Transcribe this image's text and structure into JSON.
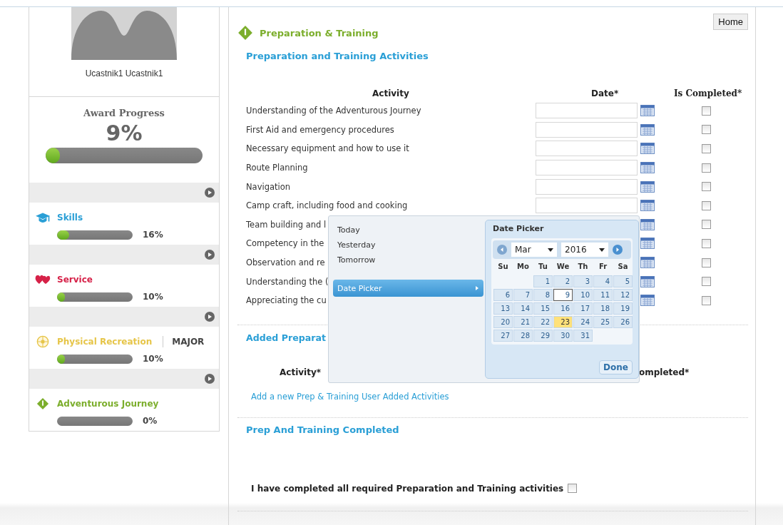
{
  "profile": {
    "name": "Ucastnik1 Ucastnik1"
  },
  "award_progress": {
    "title": "Award Progress",
    "percent": "9%",
    "level": 0.09
  },
  "categories": [
    {
      "kind": "skills",
      "name": "Skills",
      "color": "#2a9fd6",
      "percent": "16%",
      "level": 0.16
    },
    {
      "kind": "service",
      "name": "Service",
      "color": "#d62148",
      "percent": "10%",
      "level": 0.1
    },
    {
      "kind": "recreation",
      "name": "Physical Recreation",
      "color": "#e6c548",
      "percent": "10%",
      "level": 0.1,
      "tag": "MAJOR"
    },
    {
      "kind": "journey",
      "name": "Adventurous Journey",
      "color": "#7cae2c",
      "percent": "0%",
      "level": 0
    }
  ],
  "home_button": "Home",
  "page_title": "Preparation & Training",
  "activities_section": {
    "heading": "Preparation and Training Activities",
    "columns": [
      "Activity",
      "Date*",
      "Is Completed*"
    ],
    "rows": [
      {
        "activity": "Understanding of the Adventurous Journey",
        "checked": false
      },
      {
        "activity": "First Aid and emergency procedures",
        "checked": false
      },
      {
        "activity": "Necessary equipment and how to use it",
        "checked": false
      },
      {
        "activity": "Route Planning",
        "checked": false
      },
      {
        "activity": "Navigation",
        "checked": false
      },
      {
        "activity": "Camp craft, including food and cooking",
        "checked": false
      },
      {
        "activity": "Team building and l",
        "checked": false,
        "date_field_hidden": true
      },
      {
        "activity": "Competency in the",
        "checked": false,
        "date_field_hidden": true
      },
      {
        "activity": "Observation and re",
        "checked": false,
        "date_field_hidden": true
      },
      {
        "activity": "Understanding the (",
        "checked": false,
        "date_field_hidden": true
      },
      {
        "activity": "Appreciating the cu",
        "checked": false,
        "date_field_hidden": true
      }
    ]
  },
  "added_section": {
    "heading": "Added Preparat",
    "columns": [
      "Activity*",
      "ompleted*"
    ],
    "link": "Add a new Prep & Training User Added Activities"
  },
  "completed_section": {
    "heading": "Prep And Training Completed",
    "confirmation": "I have completed all required Preparation and Training activities",
    "checked": false
  },
  "date_popup": {
    "menu": [
      {
        "label": "Today",
        "selected": false
      },
      {
        "label": "Yesterday",
        "selected": false
      },
      {
        "label": "Tomorrow",
        "selected": false
      },
      {
        "label": "Date Picker",
        "selected": true
      }
    ],
    "calendar": {
      "title": "Date Picker",
      "month": "Mar",
      "year": "2016",
      "weekdays": [
        "Su",
        "Mo",
        "Tu",
        "We",
        "Th",
        "Fr",
        "Sa"
      ],
      "weeks": [
        [
          {
            "kind": "empty"
          },
          {
            "kind": "empty"
          },
          {
            "day": "1",
            "selected": false,
            "today": false
          },
          {
            "day": "2",
            "selected": false,
            "today": false
          },
          {
            "day": "3",
            "selected": false,
            "today": false
          },
          {
            "day": "4",
            "selected": false,
            "today": false
          },
          {
            "day": "5",
            "selected": false,
            "today": false
          }
        ],
        [
          {
            "day": "6",
            "selected": false,
            "today": false
          },
          {
            "day": "7",
            "selected": false,
            "today": false
          },
          {
            "day": "8",
            "selected": false,
            "today": false
          },
          {
            "day": "9",
            "selected": false,
            "today": true
          },
          {
            "day": "10",
            "selected": false,
            "today": false
          },
          {
            "day": "11",
            "selected": false,
            "today": false
          },
          {
            "day": "12",
            "selected": false,
            "today": false
          }
        ],
        [
          {
            "day": "13",
            "selected": false,
            "today": false
          },
          {
            "day": "14",
            "selected": false,
            "today": false
          },
          {
            "day": "15",
            "selected": false,
            "today": false
          },
          {
            "day": "16",
            "selected": false,
            "today": false
          },
          {
            "day": "17",
            "selected": false,
            "today": false
          },
          {
            "day": "18",
            "selected": false,
            "today": false
          },
          {
            "day": "19",
            "selected": false,
            "today": false
          }
        ],
        [
          {
            "day": "20",
            "selected": false,
            "today": false
          },
          {
            "day": "21",
            "selected": false,
            "today": false
          },
          {
            "day": "22",
            "selected": false,
            "today": false
          },
          {
            "day": "23",
            "selected": true,
            "today": false
          },
          {
            "day": "24",
            "selected": false,
            "today": false
          },
          {
            "day": "25",
            "selected": false,
            "today": false
          },
          {
            "day": "26",
            "selected": false,
            "today": false
          }
        ],
        [
          {
            "day": "27",
            "selected": false,
            "today": false
          },
          {
            "day": "28",
            "selected": false,
            "today": false
          },
          {
            "day": "29",
            "selected": false,
            "today": false
          },
          {
            "day": "30",
            "selected": false,
            "today": false
          },
          {
            "day": "31",
            "selected": false,
            "today": false
          },
          {
            "kind": "empty"
          },
          {
            "kind": "empty"
          }
        ]
      ],
      "done": "Done"
    }
  }
}
